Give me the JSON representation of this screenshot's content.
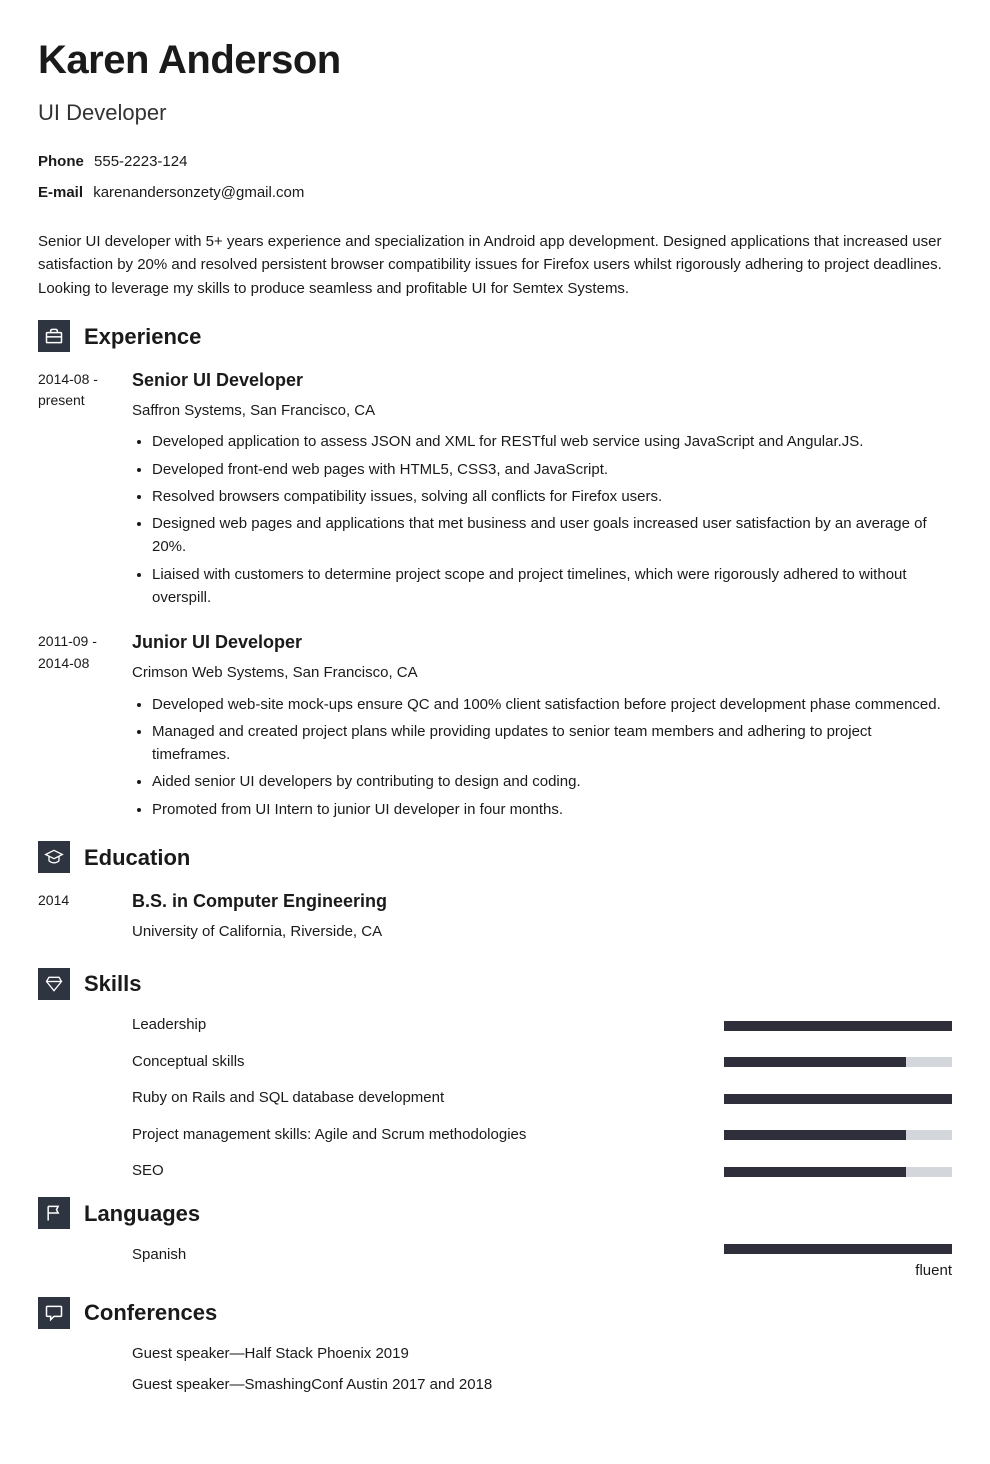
{
  "header": {
    "name": "Karen Anderson",
    "title": "UI Developer",
    "phone_label": "Phone",
    "phone": "555-2223-124",
    "email_label": "E-mail",
    "email": "karenandersonzety@gmail.com"
  },
  "summary": "Senior UI developer with 5+ years experience and specialization in Android app development. Designed applications that increased user satisfaction by 20% and resolved persistent browser compatibility issues for Firefox users whilst rigorously adhering to project deadlines. Looking to leverage my skills to produce seamless and profitable UI for Semtex Systems.",
  "sections": {
    "experience": {
      "title": "Experience",
      "items": [
        {
          "date": "2014-08 - present",
          "role": "Senior UI Developer",
          "company": "Saffron Systems, San Francisco, CA",
          "bullets": [
            "Developed application to assess JSON and XML for RESTful web service using JavaScript and Angular.JS.",
            "Developed front-end web pages with HTML5, CSS3, and JavaScript.",
            "Resolved browsers compatibility issues, solving all conflicts for Firefox users.",
            "Designed web pages and applications that met business and user goals increased user satisfaction by an average of 20%.",
            "Liaised with customers to determine project scope and project timelines, which were rigorously adhered to without overspill."
          ]
        },
        {
          "date": "2011-09 - 2014-08",
          "role": "Junior UI Developer",
          "company": "Crimson Web Systems, San Francisco, CA",
          "bullets": [
            "Developed web-site mock-ups ensure QC and 100% client satisfaction before project development phase commenced.",
            "Managed and created project plans while providing updates to senior team members and adhering to project timeframes.",
            "Aided senior UI developers by contributing to design and coding.",
            "Promoted from UI Intern to junior UI developer in four months."
          ]
        }
      ]
    },
    "education": {
      "title": "Education",
      "items": [
        {
          "date": "2014",
          "degree": "B.S. in Computer Engineering",
          "school": "University of California, Riverside, CA"
        }
      ]
    },
    "skills": {
      "title": "Skills",
      "items": [
        {
          "label": "Leadership",
          "level": 100
        },
        {
          "label": "Conceptual skills",
          "level": 80
        },
        {
          "label": "Ruby on Rails and SQL database development",
          "level": 100
        },
        {
          "label": "Project management skills: Agile and Scrum methodologies",
          "level": 80
        },
        {
          "label": "SEO",
          "level": 80
        }
      ]
    },
    "languages": {
      "title": "Languages",
      "items": [
        {
          "label": "Spanish",
          "level_text": "fluent",
          "level": 100
        }
      ]
    },
    "conferences": {
      "title": "Conferences",
      "items": [
        "Guest speaker—Half Stack Phoenix 2019",
        "Guest speaker—SmashingConf Austin 2017 and 2018"
      ]
    }
  }
}
